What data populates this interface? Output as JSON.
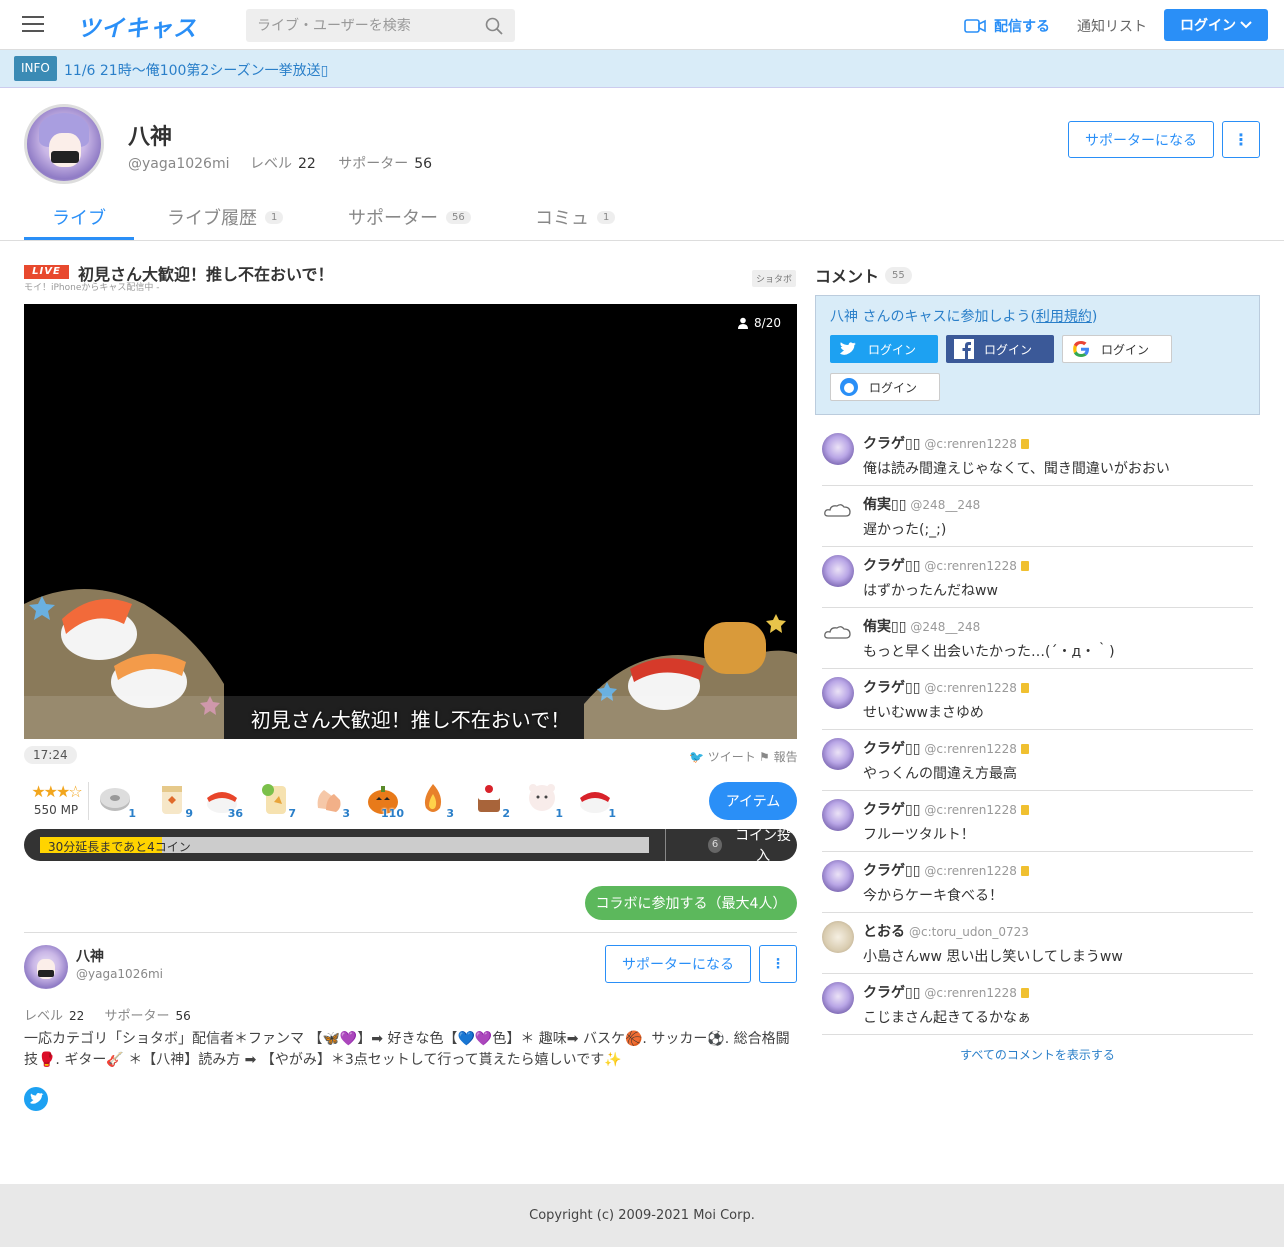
{
  "header": {
    "logo": "ツイキャス",
    "search_placeholder": "ライブ・ユーザーを検索",
    "broadcast_label": "配信する",
    "notice_label": "通知リスト",
    "login_label": "ログイン"
  },
  "info": {
    "tag": "INFO",
    "text": "11/6 21時〜俺100第2シーズン一挙放送▯"
  },
  "profile": {
    "name": "八神",
    "id": "@yaga1026mi",
    "level_label": "レベル",
    "level": "22",
    "supporter_label": "サポーター",
    "supporters": "56",
    "support_button": "サポーターになる",
    "more_button": "⋮"
  },
  "tabs": [
    {
      "label": "ライブ",
      "count": ""
    },
    {
      "label": "ライブ履歴",
      "count": "1"
    },
    {
      "label": "サポーター",
      "count": "56"
    },
    {
      "label": "コミュ",
      "count": "1"
    }
  ],
  "live": {
    "badge": "LIVE",
    "title": "初見さん大歓迎！推し不在おいで！",
    "subtitle": "モイ！iPhoneからキャス配信中 -",
    "category": "ショタボ",
    "viewers": "8/20",
    "caption": "初見さん大歓迎！推し不在おいで！",
    "time": "17:24",
    "tweet_label": "ツイート",
    "report_label": "報告"
  },
  "mp": {
    "stars": "★★★☆",
    "value": "550 MP"
  },
  "items": [
    {
      "icon": "grey-disc-icon",
      "count": "1"
    },
    {
      "icon": "tea-cup-icon",
      "count": "9"
    },
    {
      "icon": "salmon-sushi-icon",
      "count": "36"
    },
    {
      "icon": "ten-bag-icon",
      "count": "7"
    },
    {
      "icon": "clap-icon",
      "count": "3"
    },
    {
      "icon": "pumpkin-icon",
      "count": "110"
    },
    {
      "icon": "fire-icon",
      "count": "3"
    },
    {
      "icon": "cake-icon",
      "count": "2"
    },
    {
      "icon": "bear-icon",
      "count": "1"
    },
    {
      "icon": "tuna-sushi-icon",
      "count": "1"
    }
  ],
  "item_button": "アイテム",
  "extend": {
    "label": "30分延長まであと4コイン",
    "progress": 0.2,
    "coin_count": "6",
    "coin_button": "コイン投入"
  },
  "collab_button": "コラボに参加する（最大4人）",
  "about": {
    "name": "八神",
    "id": "@yaga1026mi",
    "support_button": "サポーターになる",
    "more_button": "⋮",
    "level_label": "レベル",
    "level": "22",
    "supporter_label": "サポーター",
    "supporters": "56",
    "bio": "一応カテゴリ「ショタボ」配信者＊ファンマ 【🦋💜】➡ 好きな色【💙💜色】＊ 趣味➡ バスケ🏀. サッカー⚽. 総合格闘技🥊. ギター🎸 ＊【八神】読み方 ➡ 【やがみ】＊3点セットして行って貰えたら嬉しいです✨"
  },
  "comments": {
    "title": "コメント",
    "count": "55",
    "join_text": "八神 さんのキャスに参加しよう(",
    "join_link": "利用規約",
    "join_end": ")",
    "login_label": "ログイン",
    "show_all": "すべてのコメントを表示する",
    "list": [
      {
        "name": "クラゲ▯▯",
        "id": "@c:renren1228",
        "avatar": "kurage",
        "msg": "俺は読み間違えじゃなくて、聞き間違いがおおい"
      },
      {
        "name": "侑実▯▯",
        "id": "@248__248",
        "avatar": "cloud",
        "msg": "遅かった(;_;)"
      },
      {
        "name": "クラゲ▯▯",
        "id": "@c:renren1228",
        "avatar": "kurage",
        "msg": "はずかったんだねww"
      },
      {
        "name": "侑実▯▯",
        "id": "@248__248",
        "avatar": "cloud",
        "msg": "もっと早く出会いたかった…(´・д・｀)"
      },
      {
        "name": "クラゲ▯▯",
        "id": "@c:renren1228",
        "avatar": "kurage",
        "msg": "せいむwwまさゆめ"
      },
      {
        "name": "クラゲ▯▯",
        "id": "@c:renren1228",
        "avatar": "kurage",
        "msg": "やっくんの間違え方最高"
      },
      {
        "name": "クラゲ▯▯",
        "id": "@c:renren1228",
        "avatar": "kurage",
        "msg": "フルーツタルト！"
      },
      {
        "name": "クラゲ▯▯",
        "id": "@c:renren1228",
        "avatar": "kurage",
        "msg": "今からケーキ食べる！"
      },
      {
        "name": "とおる",
        "id": "@c:toru_udon_0723",
        "avatar": "toru",
        "msg": "小島さんww 思い出し笑いしてしまうww"
      },
      {
        "name": "クラゲ▯▯",
        "id": "@c:renren1228",
        "avatar": "kurage",
        "msg": "こじまさん起きてるかなぁ"
      }
    ]
  },
  "footer": "Copyright (c) 2009-2021 Moi Corp."
}
